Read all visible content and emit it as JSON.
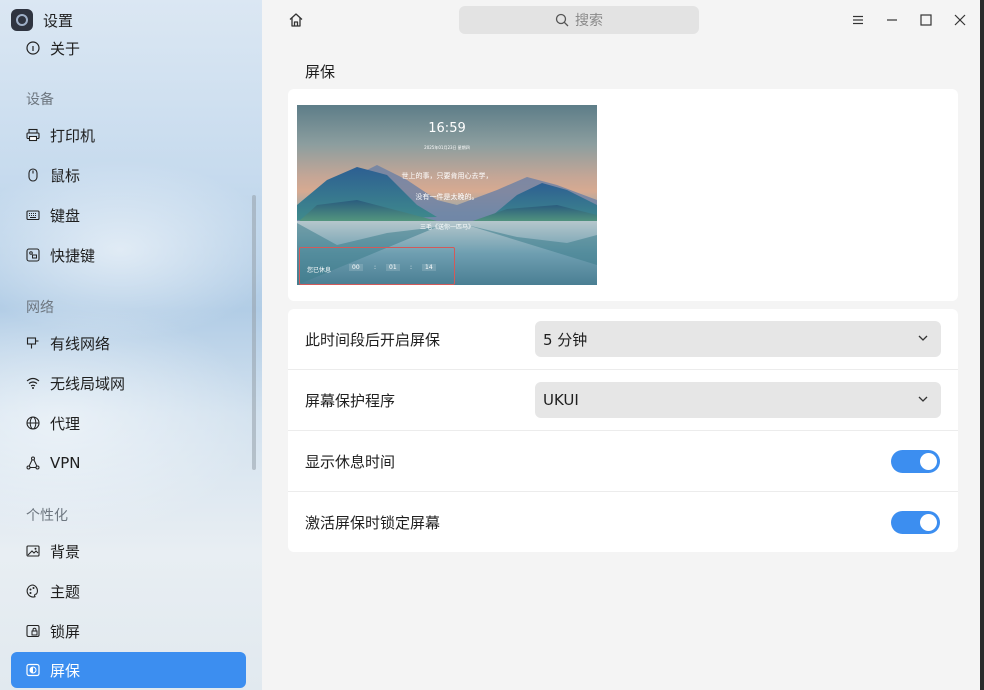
{
  "app": {
    "title": "设置",
    "icon": "settings-app-icon"
  },
  "sidebar": {
    "partial_item": {
      "label": "关于",
      "icon": "info-icon"
    },
    "sections": [
      {
        "label": "设备",
        "items": [
          {
            "label": "打印机",
            "icon": "printer-icon"
          },
          {
            "label": "鼠标",
            "icon": "mouse-icon"
          },
          {
            "label": "键盘",
            "icon": "keyboard-icon"
          },
          {
            "label": "快捷键",
            "icon": "shortcut-icon"
          }
        ]
      },
      {
        "label": "网络",
        "items": [
          {
            "label": "有线网络",
            "icon": "wired-network-icon"
          },
          {
            "label": "无线局域网",
            "icon": "wifi-icon"
          },
          {
            "label": "代理",
            "icon": "proxy-icon"
          },
          {
            "label": "VPN",
            "icon": "vpn-icon"
          }
        ]
      },
      {
        "label": "个性化",
        "items": [
          {
            "label": "背景",
            "icon": "background-icon"
          },
          {
            "label": "主题",
            "icon": "theme-icon"
          },
          {
            "label": "锁屏",
            "icon": "lockscreen-icon"
          },
          {
            "label": "屏保",
            "icon": "screensaver-icon",
            "active": true
          }
        ]
      }
    ]
  },
  "topbar": {
    "search_placeholder": "搜索"
  },
  "page": {
    "title": "屏保"
  },
  "preview": {
    "time": "16:59",
    "date": "2025年01月23日 星期四",
    "quote_line1": "世上的事，只要肯用心去学，",
    "quote_line2": "没有一件是太晚的。",
    "quote_author": "三毛《送你一匹马》",
    "rest_label": "您已休息",
    "rest_h": "00",
    "rest_m": "01",
    "rest_s": "14",
    "sep": ":"
  },
  "settings": {
    "delay": {
      "label": "此时间段后开启屏保",
      "value": "5 分钟"
    },
    "program": {
      "label": "屏幕保护程序",
      "value": "UKUI"
    },
    "show_rest": {
      "label": "显示休息时间",
      "on": true
    },
    "lock_on_activate": {
      "label": "激活屏保时锁定屏幕",
      "on": true
    }
  },
  "colors": {
    "accent": "#3c8ef0",
    "card": "#ffffff",
    "background": "#f4f4f4"
  }
}
